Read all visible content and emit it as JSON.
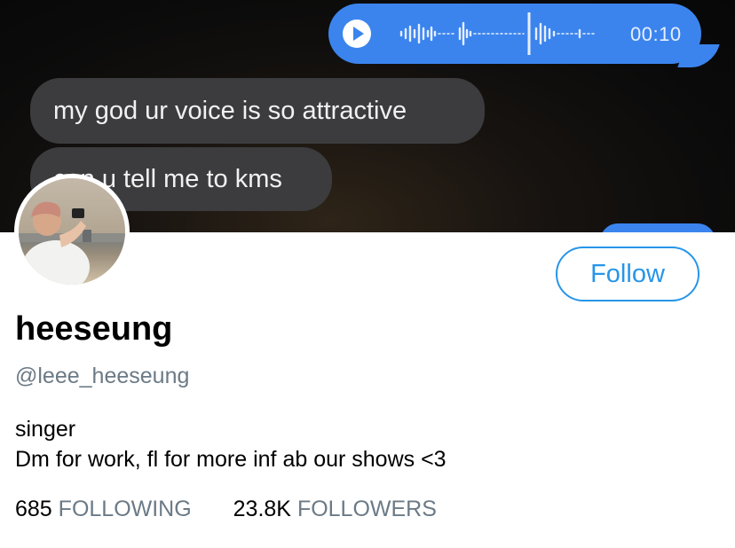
{
  "banner": {
    "voice_message": {
      "duration": "00:10",
      "play_icon": "play-icon"
    },
    "messages": [
      "my god ur voice is so attractive",
      "can u tell me to kms"
    ],
    "colors": {
      "sent_bubble": "#3b84ee",
      "received_bubble": "#3c3c3e"
    }
  },
  "profile": {
    "display_name": "heeseung",
    "handle": "@leee_heeseung",
    "follow_label": "Follow",
    "bio": [
      "singer",
      "Dm for work, fl for more inf ab our shows <3"
    ],
    "stats": {
      "following_count": "685",
      "following_label": "FOLLOWING",
      "followers_count": "23.8K",
      "followers_label": "FOLLOWERS"
    },
    "colors": {
      "accent": "#2795e9",
      "secondary_text": "#6b7a86"
    }
  }
}
